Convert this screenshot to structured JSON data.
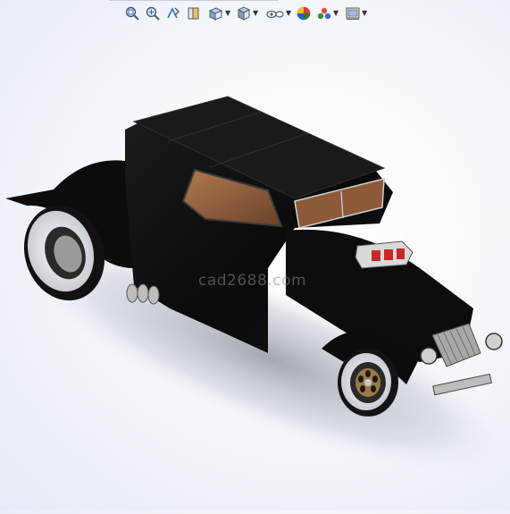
{
  "toolbar": {
    "items": [
      {
        "name": "zoom-to-fit",
        "icon": "zoom-fit-icon",
        "has_dropdown": false
      },
      {
        "name": "zoom-to-area",
        "icon": "zoom-area-icon",
        "has_dropdown": false
      },
      {
        "name": "previous-view",
        "icon": "previous-view-icon",
        "has_dropdown": false
      },
      {
        "name": "section-view",
        "icon": "section-view-icon",
        "has_dropdown": false
      },
      {
        "name": "view-orientation",
        "icon": "view-orientation-icon",
        "has_dropdown": true
      },
      {
        "name": "display-style",
        "icon": "display-style-icon",
        "has_dropdown": true
      },
      {
        "name": "hide-show-items",
        "icon": "hide-show-icon",
        "has_dropdown": true
      },
      {
        "name": "edit-appearance",
        "icon": "edit-appearance-icon",
        "has_dropdown": false
      },
      {
        "name": "apply-scene",
        "icon": "apply-scene-icon",
        "has_dropdown": true
      },
      {
        "name": "view-settings",
        "icon": "view-settings-icon",
        "has_dropdown": true
      }
    ]
  },
  "viewport": {
    "model": "hot-rod-car-3d-model",
    "watermark": "cad2688.com"
  },
  "colors": {
    "body": "#0b0b0b",
    "interior": "#8a5a3a",
    "tire_wall": "#e6e8ea",
    "chrome": "#c8c8c8",
    "background": "#f6f8fc"
  }
}
